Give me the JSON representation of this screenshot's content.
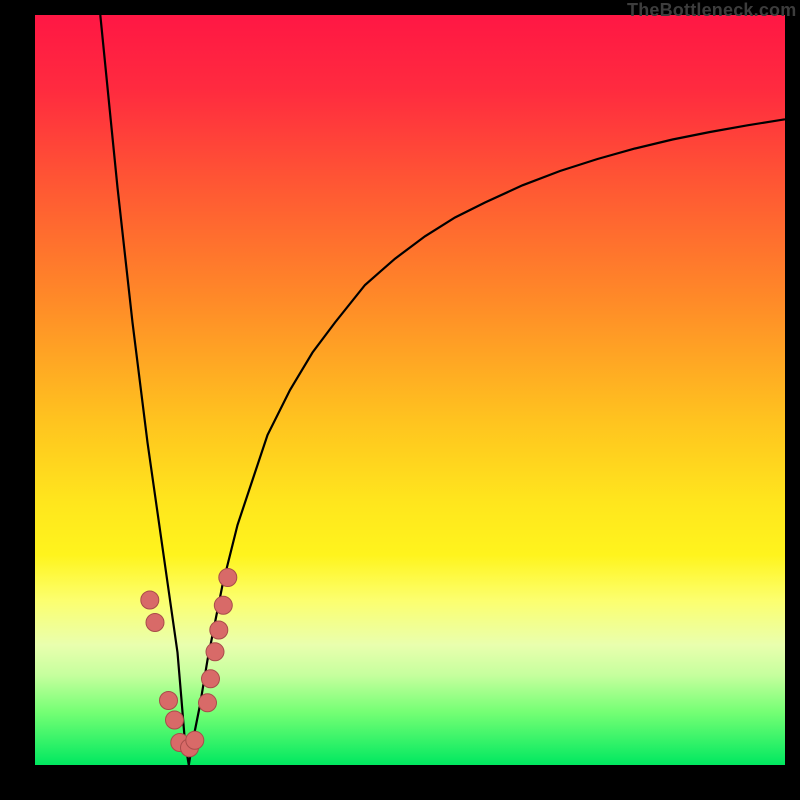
{
  "watermark": "TheBottleneck.com",
  "colors": {
    "frame": "#000000",
    "curve": "#000000",
    "marker_fill": "#d86a68",
    "marker_stroke": "#a84c4a"
  },
  "chart_data": {
    "type": "line",
    "title": "",
    "xlabel": "",
    "ylabel": "",
    "xlim": [
      0,
      100
    ],
    "ylim": [
      0,
      100
    ],
    "grid": false,
    "series": [
      {
        "name": "mismatch-curve",
        "comment": "Single V-shaped curve; left branch falls steeply to ~0 at x≈20, right branch rises asymptotically toward ~92.",
        "x": [
          8.7,
          10,
          11,
          12,
          13,
          14,
          15,
          16,
          17,
          18,
          19,
          19.5,
          20,
          20.5,
          21,
          22,
          23,
          24,
          25,
          27,
          29,
          31,
          34,
          37,
          40,
          44,
          48,
          52,
          56,
          60,
          65,
          70,
          75,
          80,
          85,
          90,
          95,
          100
        ],
        "y": [
          100,
          87,
          77,
          68,
          59,
          51,
          43,
          36,
          29,
          22,
          15,
          9,
          3,
          0,
          3,
          8,
          14,
          19,
          24,
          32,
          38,
          44,
          50,
          55,
          59,
          64,
          67.5,
          70.5,
          73,
          75,
          77.3,
          79.2,
          80.8,
          82.2,
          83.4,
          84.4,
          85.3,
          86.1
        ]
      }
    ],
    "markers": {
      "name": "highlight-dots",
      "comment": "Salmon dots clustered near the trough of the V.",
      "x": [
        15.3,
        16.0,
        17.8,
        18.6,
        19.3,
        20.6,
        21.3,
        23,
        23.4,
        24.0,
        24.5,
        25.1,
        25.7
      ],
      "y": [
        22.0,
        19.0,
        8.6,
        6.0,
        3.0,
        2.3,
        3.3,
        8.3,
        11.5,
        15.1,
        18.0,
        21.3,
        25.0
      ]
    }
  }
}
